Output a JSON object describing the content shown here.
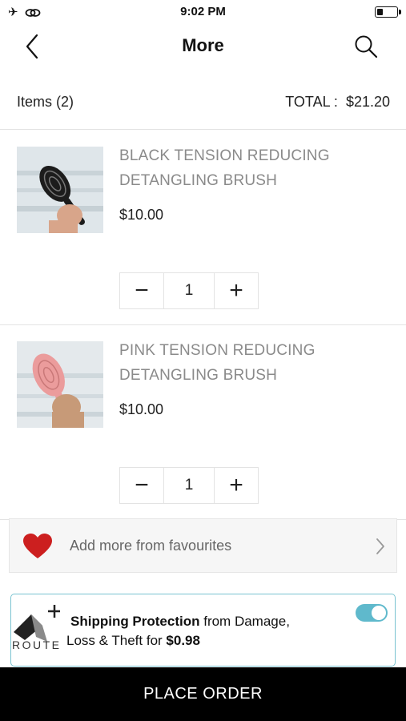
{
  "status_bar": {
    "time": "9:02 PM",
    "left_icons": [
      "airplane-icon",
      "link-icon"
    ],
    "battery_level": 0.3
  },
  "nav": {
    "title": "More",
    "back_icon": "chevron-left-icon",
    "search_icon": "search-icon"
  },
  "cart": {
    "items_label": "Items (2)",
    "total_label": "TOTAL :",
    "total_value": "$21.20"
  },
  "products": [
    {
      "name": "BLACK TENSION REDUCING DETANGLING BRUSH",
      "price": "$10.00",
      "quantity": "1",
      "minus": "−",
      "plus": "+",
      "brush_color": "#1c1c1c"
    },
    {
      "name": "PINK TENSION REDUCING DETANGLING BRUSH",
      "price": "$10.00",
      "quantity": "1",
      "minus": "−",
      "plus": "+",
      "brush_color": "#eb9c9c"
    }
  ],
  "favourites": {
    "label": "Add more from favourites",
    "icon": "heart-icon",
    "heart_color": "#cc1f1f"
  },
  "shipping": {
    "brand": "ROUTE",
    "line1_bold": "Shipping Protection",
    "line1_rest": " from Damage,",
    "line2_rest": "Loss & Theft for ",
    "line2_bold": "$0.98",
    "toggle_on": true,
    "accent": "#5fb9cc"
  },
  "footer": {
    "place_order": "PLACE ORDER"
  }
}
